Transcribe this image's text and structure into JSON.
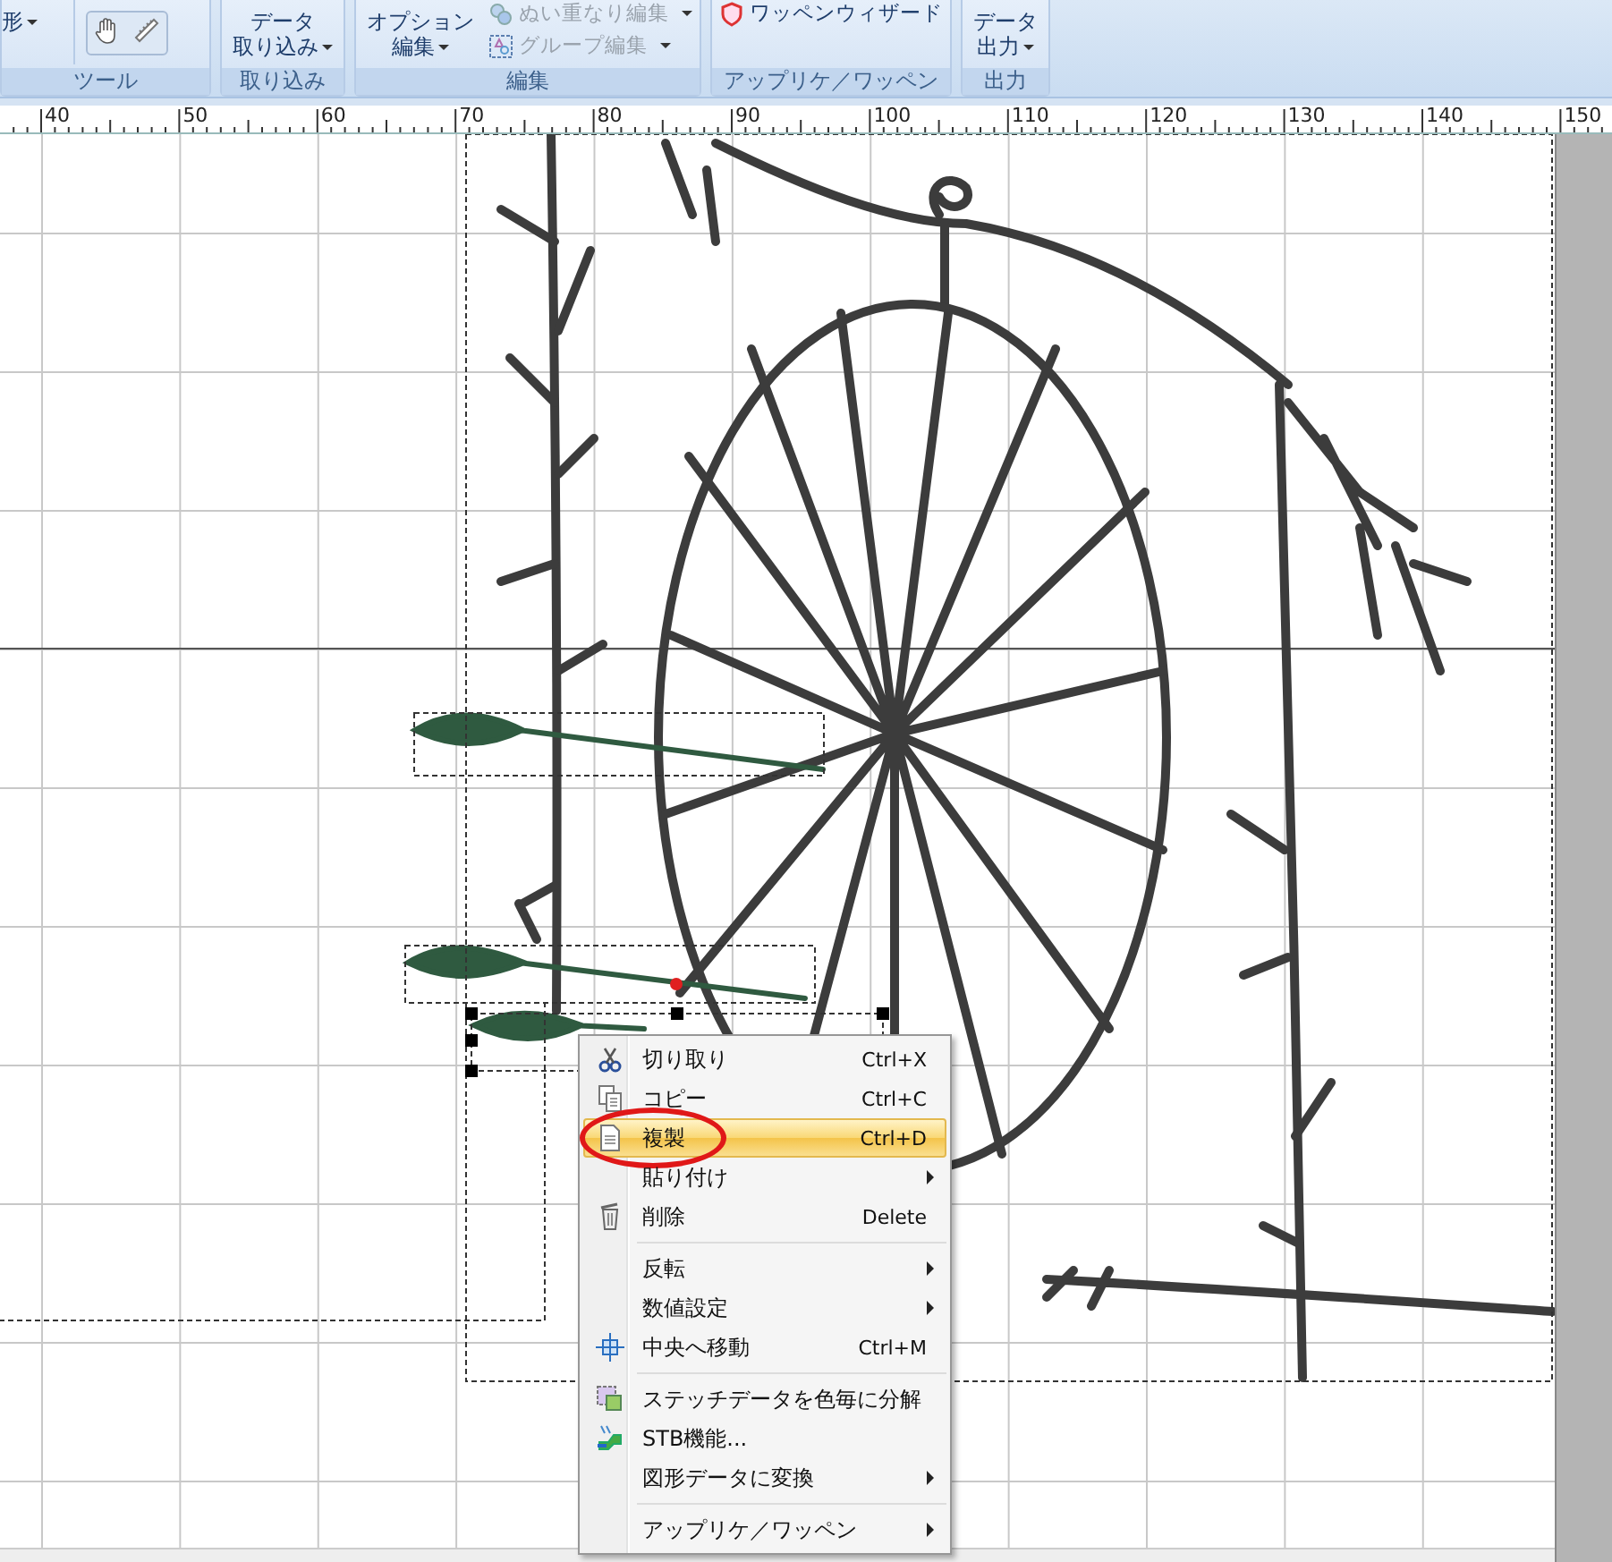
{
  "ribbon": {
    "groups": [
      {
        "label": "ツール",
        "items": [
          {
            "kind": "large",
            "lines": [
              "形"
            ],
            "caret": true,
            "disabled": false
          },
          {
            "kind": "tools"
          }
        ]
      },
      {
        "label": "取り込み",
        "items": [
          {
            "kind": "large",
            "lines": [
              "データ",
              "取り込み"
            ],
            "caret": true,
            "disabled": false
          }
        ]
      },
      {
        "label": "編集",
        "items": [
          {
            "kind": "large",
            "lines": [
              "オプション",
              "編集"
            ],
            "caret": true,
            "disabled": false
          },
          {
            "kind": "stack",
            "entries": [
              {
                "label": "ぬい重なり編集",
                "caret": true,
                "disabled": true
              },
              {
                "label": "グループ編集",
                "caret": true,
                "disabled": true
              }
            ]
          }
        ]
      },
      {
        "label": "アップリケ／ワッペン",
        "items": [
          {
            "kind": "stack",
            "entries": [
              {
                "label": "ワッペンウィザード",
                "caret": false,
                "disabled": false
              }
            ]
          }
        ]
      },
      {
        "label": "出力",
        "items": [
          {
            "kind": "large",
            "lines": [
              "データ",
              "出力"
            ],
            "caret": true,
            "disabled": false
          }
        ]
      }
    ]
  },
  "ruler": {
    "labels": [
      "40",
      "50",
      "60",
      "70",
      "80",
      "90",
      "100",
      "110",
      "120",
      "130",
      "140",
      "150"
    ]
  },
  "context_menu": {
    "items": [
      {
        "kind": "item",
        "label": "切り取り",
        "shortcut": "Ctrl+X",
        "submenu": false,
        "selected": false
      },
      {
        "kind": "item",
        "label": "コピー",
        "shortcut": "Ctrl+C",
        "submenu": false,
        "selected": false
      },
      {
        "kind": "item",
        "label": "複製",
        "shortcut": "Ctrl+D",
        "submenu": false,
        "selected": true
      },
      {
        "kind": "item",
        "label": "貼り付け",
        "submenu": true,
        "selected": false
      },
      {
        "kind": "item",
        "label": "削除",
        "shortcut": "Delete",
        "submenu": false,
        "selected": false
      },
      {
        "kind": "separator"
      },
      {
        "kind": "item",
        "label": "反転",
        "submenu": true,
        "selected": false
      },
      {
        "kind": "item",
        "label": "数値設定",
        "submenu": true,
        "selected": false
      },
      {
        "kind": "item",
        "label": "中央へ移動",
        "shortcut": "Ctrl+M",
        "submenu": false,
        "selected": false
      },
      {
        "kind": "separator"
      },
      {
        "kind": "item",
        "label": "ステッチデータを色毎に分解",
        "submenu": false,
        "selected": false
      },
      {
        "kind": "item",
        "label": "STB機能...",
        "submenu": false,
        "selected": false
      },
      {
        "kind": "item",
        "label": "図形データに変換",
        "submenu": true,
        "selected": false
      },
      {
        "kind": "separator"
      },
      {
        "kind": "item",
        "label": "アップリケ／ワッペン",
        "submenu": true,
        "selected": false
      }
    ]
  }
}
